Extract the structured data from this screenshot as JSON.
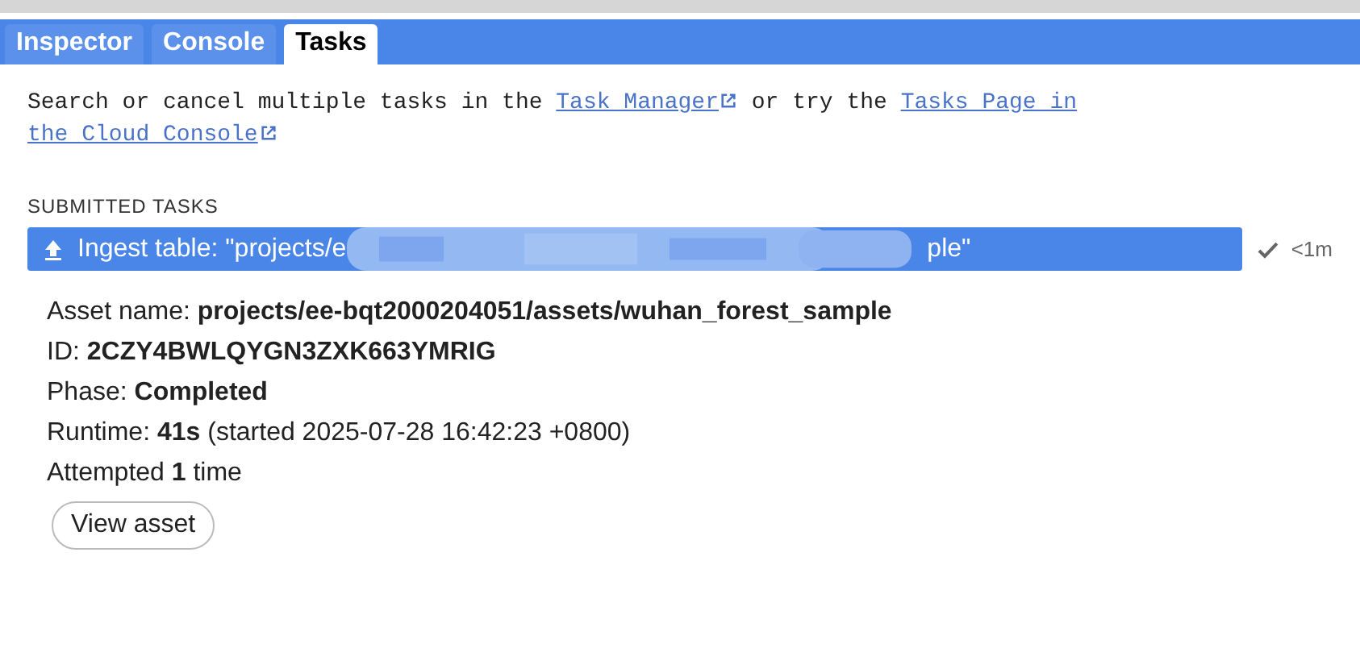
{
  "tabs": [
    {
      "label": "Inspector",
      "selected": false
    },
    {
      "label": "Console",
      "selected": false
    },
    {
      "label": "Tasks",
      "selected": true
    }
  ],
  "intro": [
    {
      "kind": "text",
      "text": "Search or cancel multiple tasks in the "
    },
    {
      "kind": "link",
      "text": "Task Manager",
      "external": true
    },
    {
      "kind": "text",
      "text": " or try the "
    },
    {
      "kind": "link",
      "text": "Tasks Page in",
      "external": false
    },
    {
      "kind": "break"
    },
    {
      "kind": "link",
      "text": "the Cloud Console",
      "external": true
    }
  ],
  "section_title": "SUBMITTED TASKS",
  "tasks": [
    {
      "title_start": "Ingest table: \"projects/e",
      "title_end": "ple\"",
      "redacted": true,
      "completed": true,
      "age": "<1m",
      "details": [
        "Asset name: **projects/ee-bqt2000204051/assets/wuhan_forest_sample**",
        "ID: **2CZY4BWLQYGN3ZXK663YMRIG**",
        "Phase: **Completed**",
        "Runtime: **41s** (started 2025-07-28 16:42:23 +0800)",
        "Attempted **1** time"
      ],
      "button": "View asset"
    }
  ]
}
